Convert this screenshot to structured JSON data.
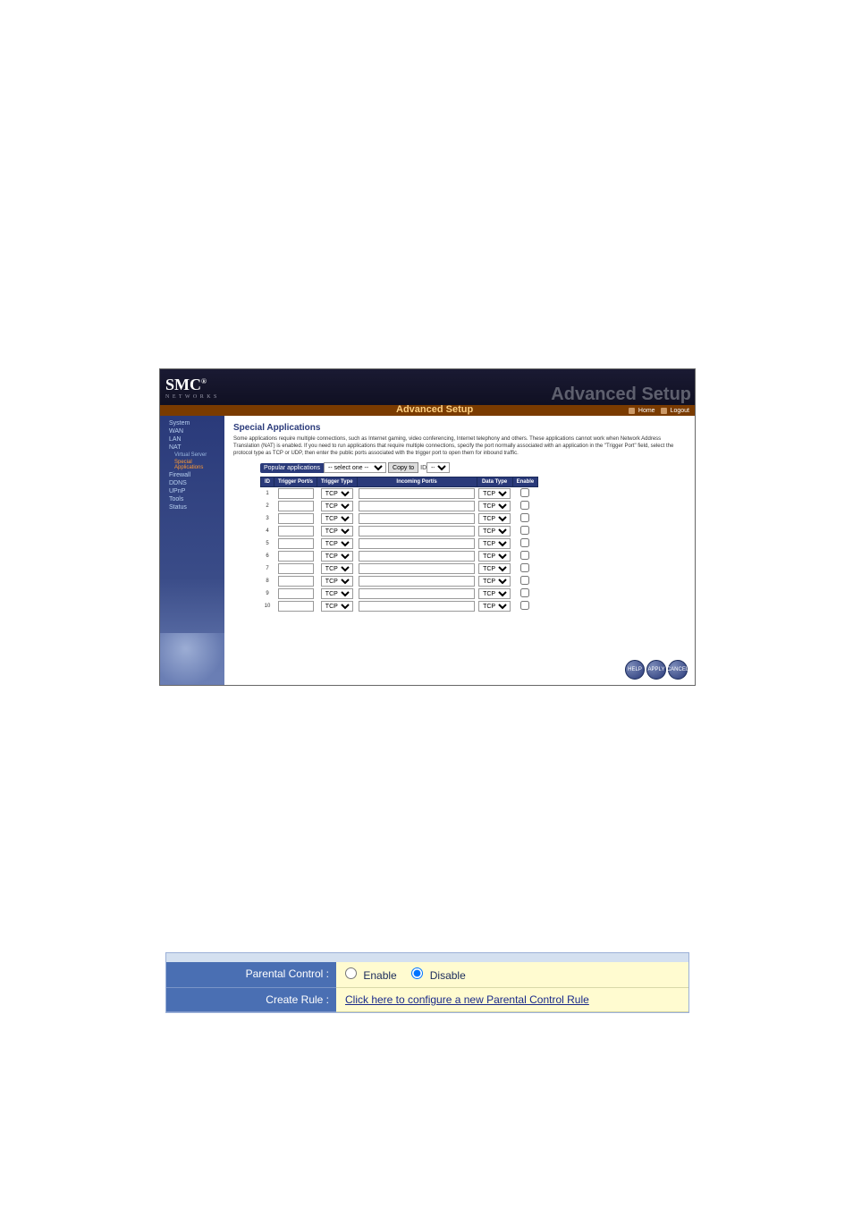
{
  "router": {
    "logo": "SMC",
    "logo_sub": "N E T W O R K S",
    "title_ghost": "Advanced Setup",
    "title": "Advanced Setup",
    "home": "Home",
    "logout": "Logout",
    "sidebar": {
      "items": [
        {
          "label": "System"
        },
        {
          "label": "WAN"
        },
        {
          "label": "LAN"
        },
        {
          "label": "NAT"
        },
        {
          "label": "Virtual Server",
          "sub": true
        },
        {
          "label": "Special Applications",
          "sub": true,
          "selected": true
        },
        {
          "label": "Firewall"
        },
        {
          "label": "DDNS"
        },
        {
          "label": "UPnP"
        },
        {
          "label": "Tools"
        },
        {
          "label": "Status"
        }
      ]
    },
    "page": {
      "heading": "Special Applications",
      "description": "Some applications require multiple connections, such as Internet gaming, video conferencing, Internet telephony and others. These applications cannot work when Network Address Translation (NAT) is enabled. If you need to run applications that require multiple connections, specify the port normally associated with an application in the \"Trigger Port\" field, select the protocol type as TCP or UDP, then enter the public ports associated with the trigger port to open them for inbound traffic.",
      "popular_label": "Popular applications",
      "popular_select": "-- select one --",
      "copy_to": "Copy to",
      "copy_idx": "--",
      "table": {
        "headers": [
          "ID",
          "Trigger Port/s",
          "Trigger Type",
          "Incoming Port/s",
          "Data Type",
          "Enable"
        ],
        "row_count": 10,
        "trigger_type_default": "TCP",
        "data_type_default": "TCP"
      },
      "buttons": {
        "help": "HELP",
        "apply": "APPLY",
        "cancel": "CANCEL"
      }
    }
  },
  "parental": {
    "row1_label": "Parental Control :",
    "enable": "Enable",
    "disable": "Disable",
    "row2_label": "Create Rule :",
    "link": "Click here to configure a new Parental Control Rule"
  }
}
